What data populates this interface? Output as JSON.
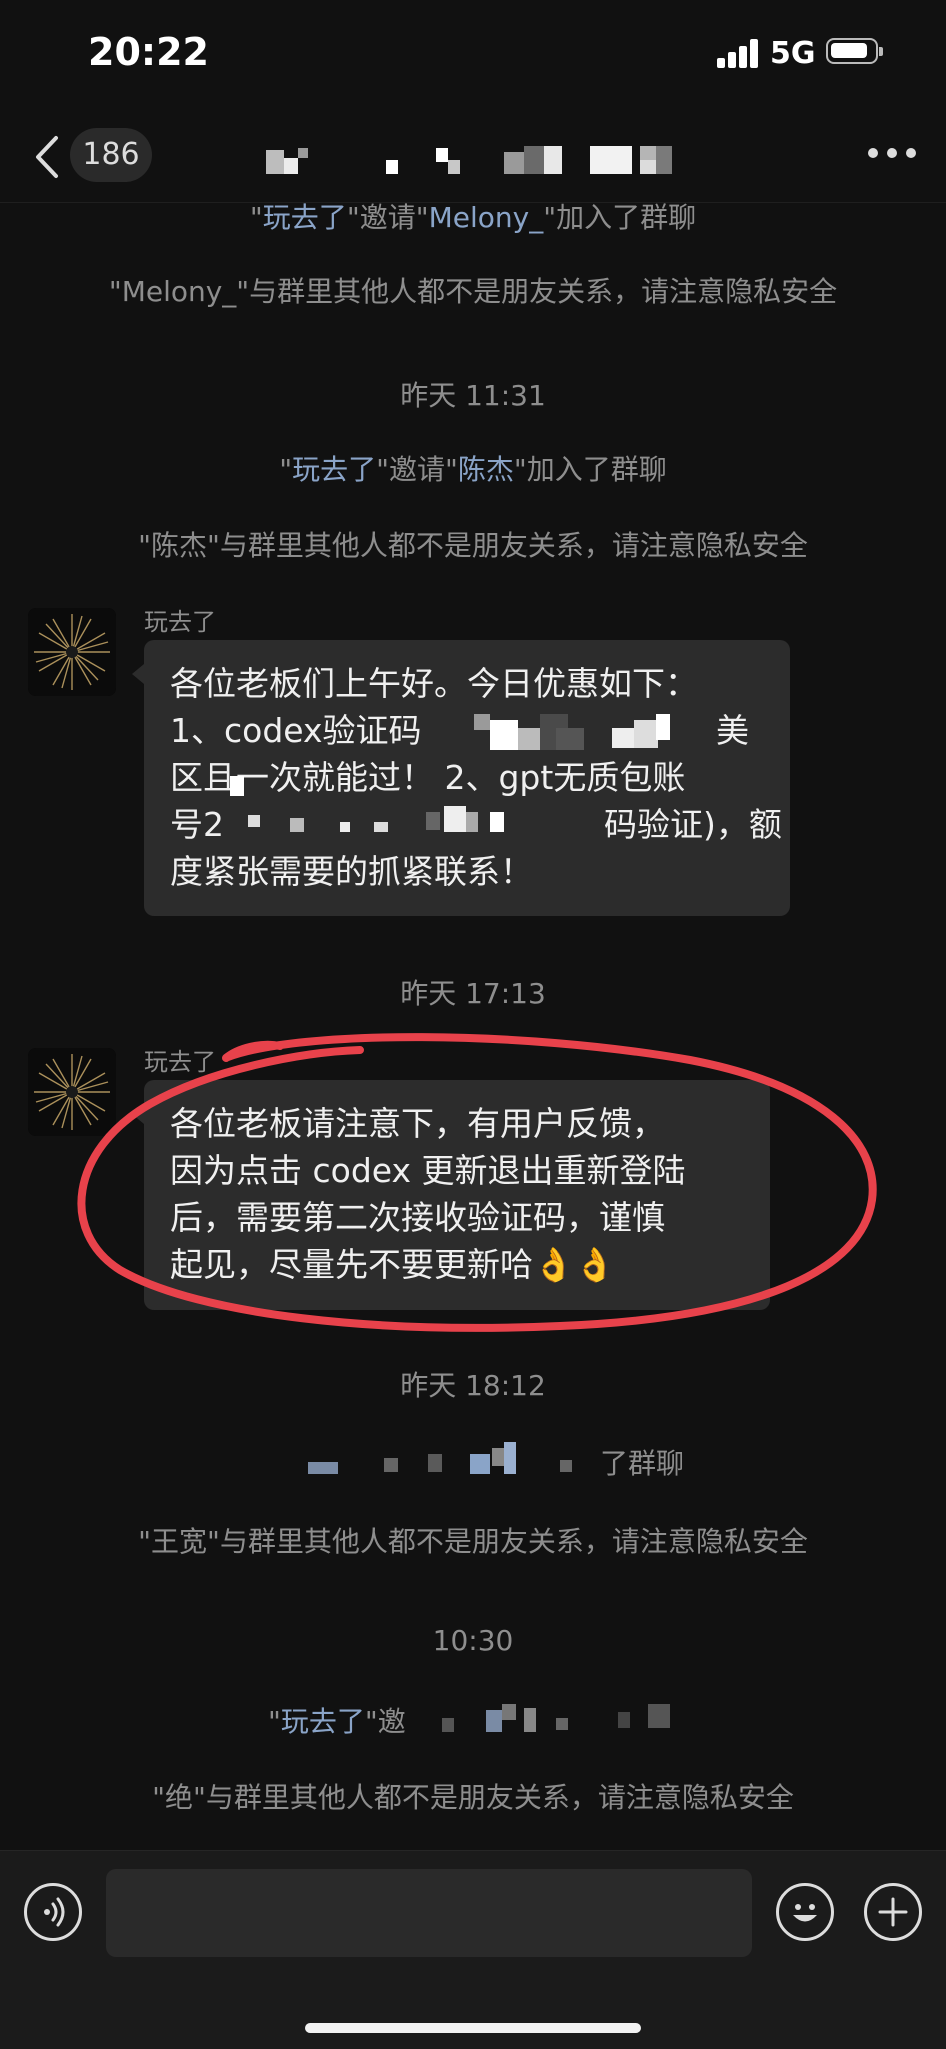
{
  "status": {
    "time": "20:22",
    "network": "5G",
    "battery_level": 0.85
  },
  "nav": {
    "back_count": "186"
  },
  "messages": {
    "sys1": {
      "name1": "玩去了",
      "mid": "\"邀请\"",
      "name2": "Melony_",
      "tail": "\"加入了群聊"
    },
    "sys2": "\"Melony_\"与群里其他人都不是朋友关系，请注意隐私安全",
    "ts1": "昨天 11:31",
    "sys3": {
      "name1": "玩去了",
      "mid": "\"邀请\"",
      "name2": "陈杰",
      "tail": "\"加入了群聊"
    },
    "sys4": "\"陈杰\"与群里其他人都不是朋友关系，请注意隐私安全",
    "msg1": {
      "sender": "玩去了",
      "lines": [
        "各位老板们上午好。今日优惠如下：",
        "1、codex验证码",
        "区且一次就能过！ 2、gpt无质包账",
        "号2",
        "度紧张需要的抓紧联系！"
      ],
      "fragments": {
        "line2_end": "美",
        "line4_end": "码验证)，额"
      }
    },
    "ts2": "昨天 17:13",
    "msg2": {
      "sender": "玩去了",
      "lines": [
        "各位老板请注意下，有用户反馈，",
        "因为点击 codex 更新退出重新登陆",
        "后，需要第二次接收验证码，谨慎",
        "起见，尽量先不要更新哈👌👌"
      ]
    },
    "ts3": "昨天 18:12",
    "sys5_tail": "了群聊",
    "sys6": "\"王宽\"与群里其他人都不是朋友关系，请注意隐私安全",
    "ts4": "10:30",
    "sys7": {
      "name1": "玩去了",
      "mid": "\"邀"
    },
    "sys8": "\"绝\"与群里其他人都不是朋友关系，请注意隐私安全"
  },
  "input": {
    "placeholder": ""
  },
  "colors": {
    "highlight_ring": "#e8424b",
    "bubble": "#2c2c2c",
    "background": "#111111",
    "link_name": "#8aa4c8"
  },
  "icons": [
    "chevron-left-icon",
    "more-icon",
    "voice-icon",
    "emoji-icon",
    "plus-icon"
  ]
}
